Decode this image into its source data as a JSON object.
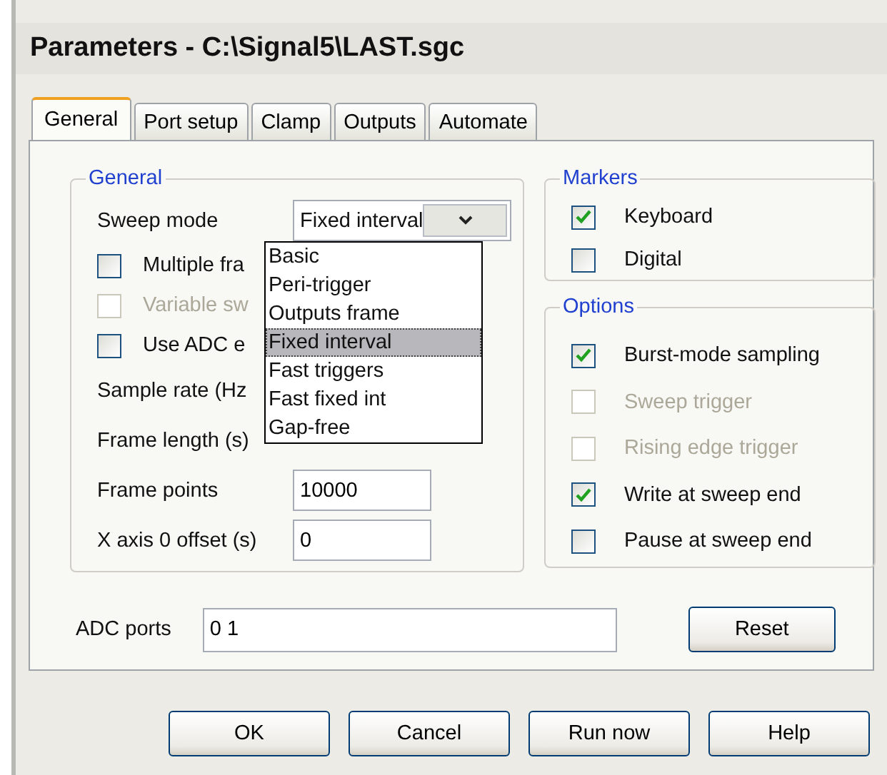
{
  "window": {
    "title": "Parameters - C:\\Signal5\\LAST.sgc"
  },
  "tabs": [
    {
      "label": "General",
      "selected": true
    },
    {
      "label": "Port setup",
      "selected": false
    },
    {
      "label": "Clamp",
      "selected": false
    },
    {
      "label": "Outputs",
      "selected": false
    },
    {
      "label": "Automate",
      "selected": false
    }
  ],
  "general": {
    "title": "General",
    "sweep_mode": {
      "label": "Sweep mode",
      "value": "Fixed interval",
      "expanded": true,
      "options": [
        {
          "label": "Basic",
          "selected": false
        },
        {
          "label": "Peri-trigger",
          "selected": false
        },
        {
          "label": "Outputs frame",
          "selected": false
        },
        {
          "label": "Fixed interval",
          "selected": true
        },
        {
          "label": "Fast triggers",
          "selected": false
        },
        {
          "label": "Fast fixed int",
          "selected": false
        },
        {
          "label": "Gap-free",
          "selected": false
        }
      ]
    },
    "checkboxes": [
      {
        "label": "Multiple fra",
        "checked": false,
        "disabled": false
      },
      {
        "label": "Variable sw",
        "checked": false,
        "disabled": true
      },
      {
        "label": "Use ADC e",
        "checked": false,
        "disabled": false
      }
    ],
    "fields": [
      {
        "label": "Sample rate (Hz"
      },
      {
        "label": "Frame length (s)"
      },
      {
        "label": "Frame points",
        "value": "10000"
      },
      {
        "label": "X axis 0 offset (s)",
        "value": "0"
      }
    ]
  },
  "markers": {
    "title": "Markers",
    "checkboxes": [
      {
        "label": "Keyboard",
        "checked": true,
        "disabled": false
      },
      {
        "label": "Digital",
        "checked": false,
        "disabled": false
      }
    ]
  },
  "options": {
    "title": "Options",
    "checkboxes": [
      {
        "label": "Burst-mode sampling",
        "checked": true,
        "disabled": false
      },
      {
        "label": "Sweep trigger",
        "checked": false,
        "disabled": true
      },
      {
        "label": "Rising edge trigger",
        "checked": false,
        "disabled": true
      },
      {
        "label": "Write at sweep end",
        "checked": true,
        "disabled": false
      },
      {
        "label": "Pause at sweep end",
        "checked": false,
        "disabled": false
      }
    ]
  },
  "adc_ports": {
    "label": "ADC ports",
    "value": "0 1",
    "button": "Reset"
  },
  "buttons": [
    "OK",
    "Cancel",
    "Run now",
    "Help"
  ]
}
